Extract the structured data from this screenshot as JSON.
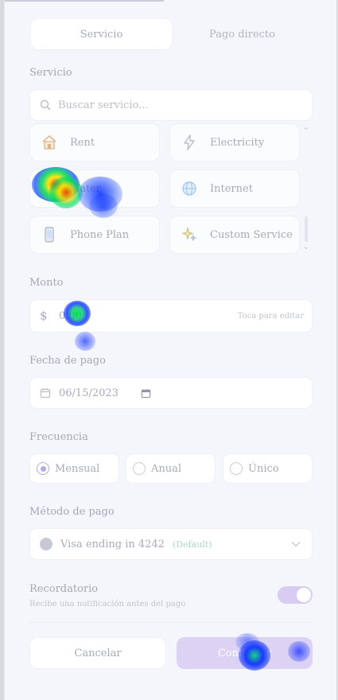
{
  "tabs": [
    {
      "label": "Servicio",
      "active": true
    },
    {
      "label": "Pago directo",
      "active": false
    }
  ],
  "service": {
    "section_label": "Servicio",
    "search_placeholder": "Buscar servicio...",
    "items": [
      {
        "label": "Rent",
        "icon": "house-icon"
      },
      {
        "label": "Electricity",
        "icon": "lightning-icon"
      },
      {
        "label": "Water",
        "icon": "water-drop-icon"
      },
      {
        "label": "Internet",
        "icon": "globe-icon"
      },
      {
        "label": "Phone Plan",
        "icon": "phone-icon"
      },
      {
        "label": "Custom Service",
        "icon": "sparkles-icon"
      }
    ]
  },
  "amount": {
    "section_label": "Monto",
    "currency": "$",
    "value": "0.00",
    "hint": "Toca para editar"
  },
  "date": {
    "section_label": "Fecha de pago",
    "value": "06/15/2023"
  },
  "frequency": {
    "section_label": "Frecuencia",
    "options": [
      {
        "label": "Mensual",
        "selected": true
      },
      {
        "label": "Anual",
        "selected": false
      },
      {
        "label": "Único",
        "selected": false
      }
    ]
  },
  "payment": {
    "section_label": "Método de pago",
    "method": "Visa ending in 4242",
    "badge": "(Default)"
  },
  "reminder": {
    "title": "Recordatorio",
    "subtitle": "Recibe una notificación antes del pago",
    "enabled": true
  },
  "actions": {
    "cancel": "Cancelar",
    "confirm": "Confirmar"
  },
  "colors": {
    "accent": "#b7a8e8",
    "confirm_bg": "#dcd3f4",
    "default_badge": "#a9dbc1"
  }
}
